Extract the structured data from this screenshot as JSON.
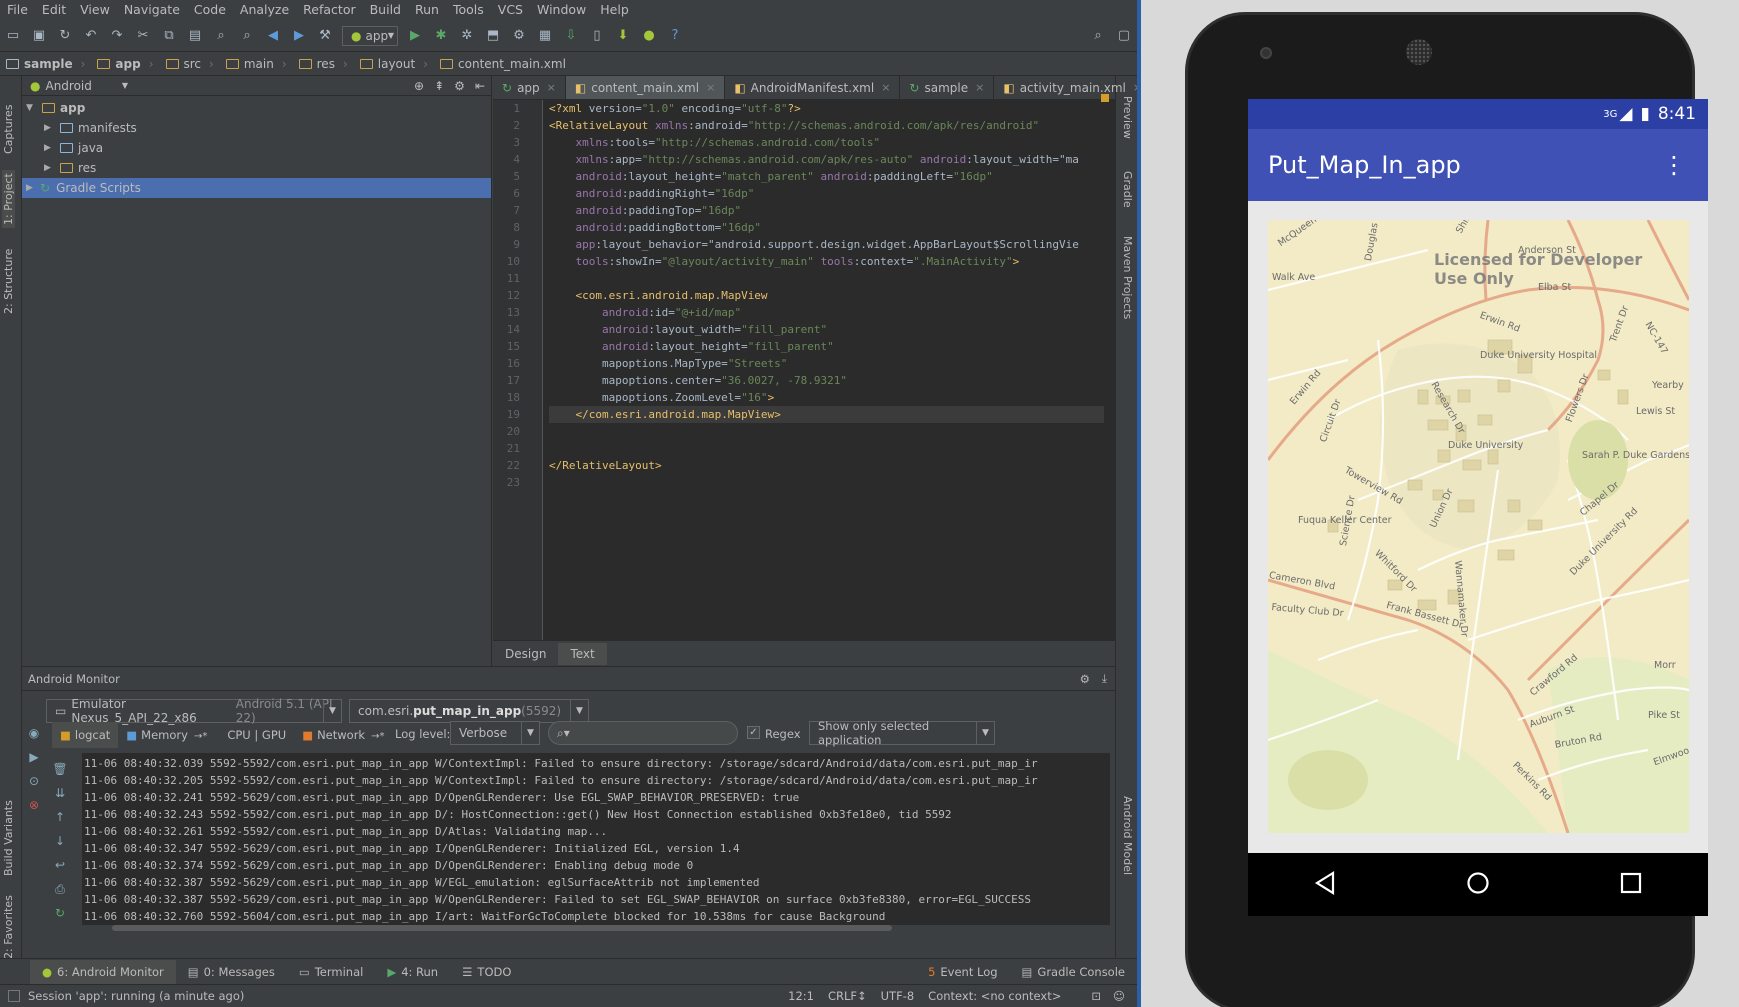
{
  "menu": [
    "File",
    "Edit",
    "View",
    "Navigate",
    "Code",
    "Analyze",
    "Refactor",
    "Build",
    "Run",
    "Tools",
    "VCS",
    "Window",
    "Help"
  ],
  "toolbar": {
    "run_config": "app"
  },
  "breadcrumbs": [
    "sample",
    "app",
    "src",
    "main",
    "res",
    "layout",
    "content_main.xml"
  ],
  "left_strip": [
    "Captures",
    "1: Project",
    "2: Structure",
    "Build Variants",
    "2: Favorites"
  ],
  "right_strip": [
    "Preview",
    "Gradle",
    "Maven Projects",
    "Android Model"
  ],
  "project": {
    "view_mode": "Android",
    "tree": [
      {
        "label": "app",
        "depth": 0,
        "expanded": true,
        "type": "module"
      },
      {
        "label": "manifests",
        "depth": 1,
        "type": "folder"
      },
      {
        "label": "java",
        "depth": 1,
        "type": "folder"
      },
      {
        "label": "res",
        "depth": 1,
        "type": "res"
      },
      {
        "label": "Gradle Scripts",
        "depth": 0,
        "type": "gradle",
        "selected": true
      }
    ]
  },
  "editor": {
    "tabs": [
      "app",
      "content_main.xml",
      "AndroidManifest.xml",
      "sample",
      "activity_main.xml"
    ],
    "active_tab": "content_main.xml",
    "lines": [
      "<?xml version=\"1.0\" encoding=\"utf-8\"?>",
      "<RelativeLayout xmlns:android=\"http://schemas.android.com/apk/res/android\"",
      "    xmlns:tools=\"http://schemas.android.com/tools\"",
      "    xmlns:app=\"http://schemas.android.com/apk/res-auto\" android:layout_width=\"ma",
      "    android:layout_height=\"match_parent\" android:paddingLeft=\"16dp\"",
      "    android:paddingRight=\"16dp\"",
      "    android:paddingTop=\"16dp\"",
      "    android:paddingBottom=\"16dp\"",
      "    app:layout_behavior=\"android.support.design.widget.AppBarLayout$ScrollingVie",
      "    tools:showIn=\"@layout/activity_main\" tools:context=\".MainActivity\">",
      "",
      "    <com.esri.android.map.MapView",
      "        android:id=\"@+id/map\"",
      "        android:layout_width=\"fill_parent\"",
      "        android:layout_height=\"fill_parent\"",
      "        mapoptions.MapType=\"Streets\"",
      "        mapoptions.center=\"36.0027, -78.9321\"",
      "        mapoptions.ZoomLevel=\"16\">",
      "    </com.esri.android.map.MapView>",
      "",
      "",
      "</RelativeLayout>",
      ""
    ],
    "bottom_tabs": [
      "Design",
      "Text"
    ],
    "active_bottom_tab": "Text"
  },
  "monitor": {
    "title": "Android Monitor",
    "device": "Emulator Nexus_5_API_22_x86",
    "device_suffix": "Android 5.1 (API 22)",
    "process_prefix": "com.esri.",
    "process_bold": "put_map_in_app",
    "process_suffix": " (5592)",
    "tabs": [
      "logcat",
      "Memory",
      "CPU | GPU",
      "Network"
    ],
    "log_level_label": "Log level:",
    "log_level": "Verbose",
    "regex_label": "Regex",
    "filter": "Show only selected application",
    "log": [
      "11-06 08:40:32.039 5592-5592/com.esri.put_map_in_app W/ContextImpl: Failed to ensure directory: /storage/sdcard/Android/data/com.esri.put_map_ir",
      "11-06 08:40:32.205 5592-5592/com.esri.put_map_in_app W/ContextImpl: Failed to ensure directory: /storage/sdcard/Android/data/com.esri.put_map_ir",
      "11-06 08:40:32.241 5592-5629/com.esri.put_map_in_app D/OpenGLRenderer: Use EGL_SWAP_BEHAVIOR_PRESERVED: true",
      "11-06 08:40:32.243 5592-5592/com.esri.put_map_in_app D/: HostConnection::get() New Host Connection established 0xb3fe18e0, tid 5592",
      "11-06 08:40:32.261 5592-5592/com.esri.put_map_in_app D/Atlas: Validating map...",
      "11-06 08:40:32.347 5592-5629/com.esri.put_map_in_app I/OpenGLRenderer: Initialized EGL, version 1.4",
      "11-06 08:40:32.374 5592-5629/com.esri.put_map_in_app D/OpenGLRenderer: Enabling debug mode 0",
      "11-06 08:40:32.387 5592-5629/com.esri.put_map_in_app W/EGL_emulation: eglSurfaceAttrib not implemented",
      "11-06 08:40:32.387 5592-5629/com.esri.put_map_in_app W/OpenGLRenderer: Failed to set EGL_SWAP_BEHAVIOR on surface 0xb3fe8380, error=EGL_SUCCESS",
      "11-06 08:40:32.760 5592-5604/com.esri.put_map_in_app I/art: WaitForGcToComplete blocked for 10.538ms for cause Background"
    ]
  },
  "bottom_tools": [
    "6: Android Monitor",
    "0: Messages",
    "Terminal",
    "4: Run",
    "TODO"
  ],
  "bottom_right_tools": [
    "Event Log",
    "Gradle Console"
  ],
  "event_log_count": "5",
  "status": {
    "message": "Session 'app': running (a minute ago)",
    "position": "12:1",
    "line_sep": "CRLF↕",
    "encoding": "UTF-8",
    "context": "Context: <no context>"
  },
  "phone": {
    "status_network": "3G",
    "time": "8:41",
    "app_title": "Put_Map_In_app",
    "watermark_line1": "Licensed for Developer",
    "watermark_line2": "Use Only",
    "map_labels": [
      "Walk Ave",
      "Elba St",
      "Erwin Rd",
      "Yearby",
      "Erwin Rd",
      "Research Dr",
      "Lewis St",
      "Duke University Hospital",
      "Duke University",
      "Sarah P. Duke Gardens",
      "Towerview Rd",
      "Chapel Dr",
      "Union Dr",
      "Circuit Dr",
      "Science Dr",
      "Fuqua Keller Center",
      "Whitford Dr",
      "Frank Bassett Dr",
      "Cameron Blvd",
      "Faculty Club Dr",
      "Wannamaker Dr",
      "Duke University Rd",
      "Crawford Rd",
      "Auburn St",
      "Bruton Rd",
      "Perkins Rd",
      "Pike St",
      "Elmwood",
      "Morr",
      "McQueen Dr",
      "Douglas St",
      "Shirley St",
      "Anderson St",
      "Flowers Dr",
      "Trent Dr",
      "NC-147"
    ],
    "colors": {
      "status_bar": "#2b3fa5",
      "app_bar": "#3f51b5",
      "map_bg": "#f3ecc8"
    }
  }
}
